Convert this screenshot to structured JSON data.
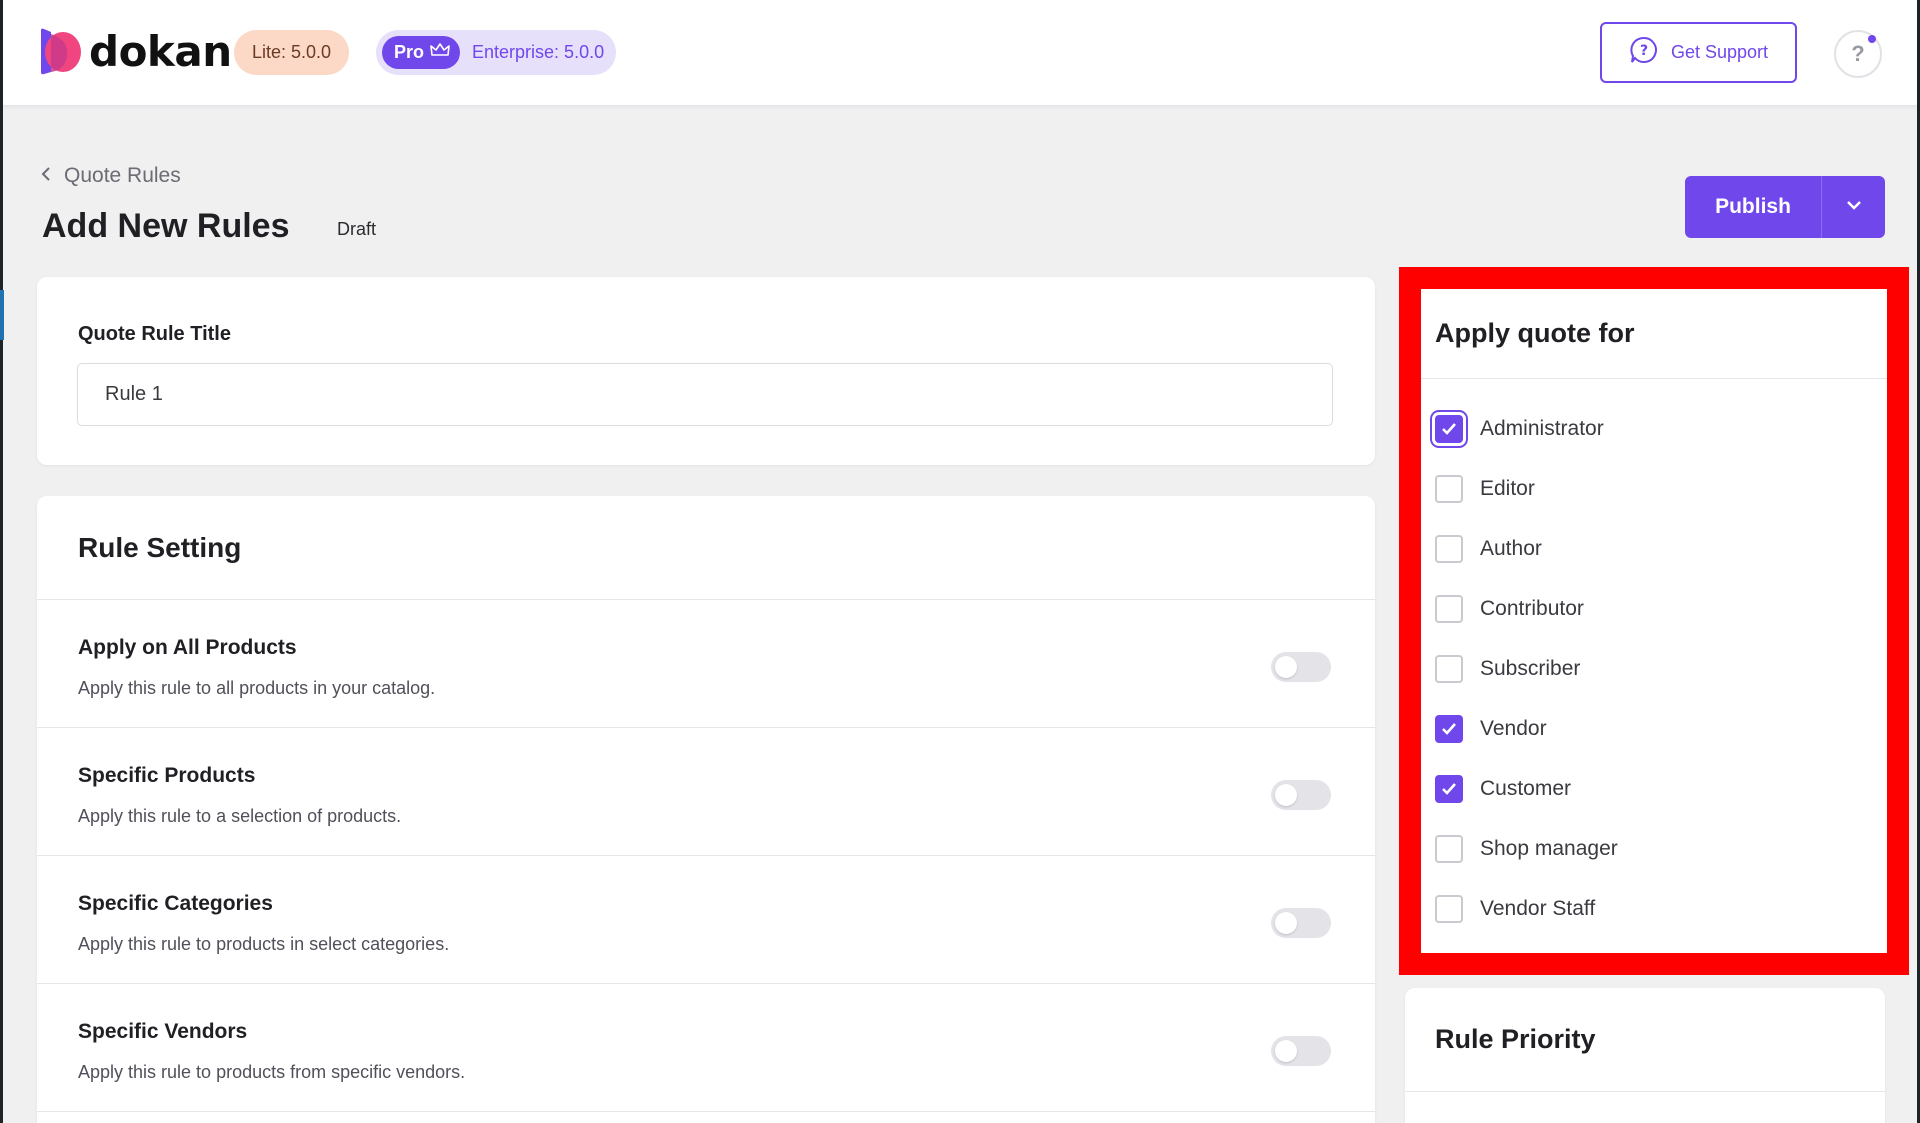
{
  "header": {
    "logo_text": "dokan",
    "lite_badge": "Lite: 5.0.0",
    "pro_badge": "Pro",
    "enterprise_badge": "Enterprise: 5.0.0",
    "support_label": "Get Support",
    "help_label": "?"
  },
  "page": {
    "breadcrumb": "Quote Rules",
    "title": "Add New Rules",
    "status": "Draft",
    "publish_label": "Publish"
  },
  "title_section": {
    "label": "Quote Rule Title",
    "value": "Rule 1"
  },
  "rule_setting": {
    "heading": "Rule Setting",
    "rows": [
      {
        "title": "Apply on All Products",
        "description": "Apply this rule to all products in your catalog.",
        "enabled": false
      },
      {
        "title": "Specific Products",
        "description": "Apply this rule to a selection of products.",
        "enabled": false
      },
      {
        "title": "Specific Categories",
        "description": "Apply this rule to products in select categories.",
        "enabled": false
      },
      {
        "title": "Specific Vendors",
        "description": "Apply this rule to products from specific vendors.",
        "enabled": false
      }
    ]
  },
  "apply_quote": {
    "heading": "Apply quote for",
    "roles": [
      {
        "label": "Administrator",
        "checked": true
      },
      {
        "label": "Editor",
        "checked": false
      },
      {
        "label": "Author",
        "checked": false
      },
      {
        "label": "Contributor",
        "checked": false
      },
      {
        "label": "Subscriber",
        "checked": false
      },
      {
        "label": "Vendor",
        "checked": true
      },
      {
        "label": "Customer",
        "checked": true
      },
      {
        "label": "Shop manager",
        "checked": false
      },
      {
        "label": "Vendor Staff",
        "checked": false
      }
    ]
  },
  "rule_priority": {
    "heading": "Rule Priority"
  },
  "colors": {
    "accent": "#7047eb",
    "highlight": "#ff0000",
    "lite_badge_bg": "#fcd9c7",
    "pro_badge_bg": "#e6e0fa"
  }
}
